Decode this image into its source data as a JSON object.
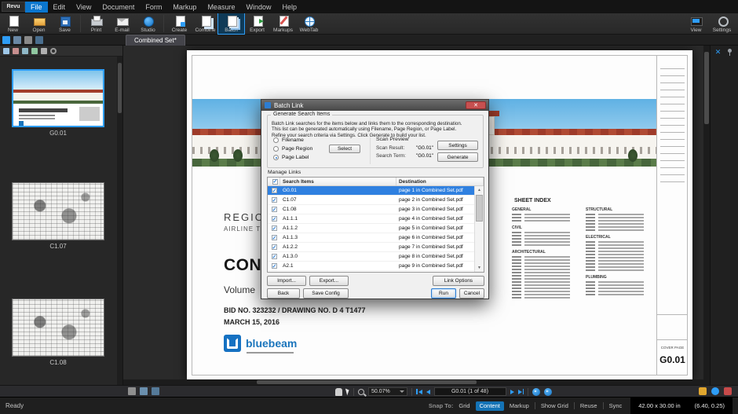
{
  "app": {
    "logo_text": "Revu",
    "menu_items": [
      "File",
      "Edit",
      "View",
      "Document",
      "Form",
      "Markup",
      "Measure",
      "Window",
      "Help"
    ],
    "active_menu": "File"
  },
  "toolbar": {
    "left_groups": [
      [
        {
          "label": "New",
          "icon": "new-document-icon"
        },
        {
          "label": "Open",
          "icon": "open-folder-icon"
        },
        {
          "label": "Save",
          "icon": "save-icon"
        }
      ],
      [
        {
          "label": "Print",
          "icon": "printer-icon"
        },
        {
          "label": "E-mail",
          "icon": "email-icon"
        },
        {
          "label": "Studio",
          "icon": "studio-icon"
        }
      ],
      [
        {
          "label": "Create",
          "icon": "create-icon"
        },
        {
          "label": "Combine",
          "icon": "combine-icon"
        },
        {
          "label": "Batch",
          "icon": "batch-icon",
          "active": true
        },
        {
          "label": "Export",
          "icon": "export-icon"
        },
        {
          "label": "Markups",
          "icon": "markups-icon"
        },
        {
          "label": "WebTab",
          "icon": "webtab-icon"
        }
      ]
    ],
    "right_group": [
      {
        "label": "View",
        "icon": "view-icon"
      },
      {
        "label": "Settings",
        "icon": "settings-icon"
      }
    ]
  },
  "tab_bar": {
    "active_tab": "Combined Set*",
    "left_icons": [
      "properties-panel-icon",
      "file-access-panel-icon",
      "thumbnails-panel-icon",
      "bookmarks-panel-icon"
    ]
  },
  "right_dock_icons": [
    "close-panel-icon",
    "pin-panel-icon"
  ],
  "thumbnail_panel": {
    "toolbar_icons": [
      "insert-page-icon",
      "delete-page-icon",
      "rotate-left-icon",
      "rotate-right-icon",
      "page-options-icon",
      "panel-gear-icon"
    ],
    "thumbnails": [
      {
        "label": "G0.01",
        "kind": "cover",
        "selected": true
      },
      {
        "label": "C1.07",
        "kind": "plan",
        "selected": false
      },
      {
        "label": "C1.08",
        "kind": "plan",
        "selected": false
      }
    ]
  },
  "document": {
    "title_line": "REGIONAL AIRPORT",
    "subtitle_line": "AIRLINE TERMINAL",
    "heading": "CONSTRUCTION DOCUMENTS",
    "volume_line": "Volume",
    "bid_line": "BID NO. 323232 /  DRAWING NO. D 4 T1477",
    "date_line": "MARCH 15, 2016",
    "brand_name": "bluebeam",
    "sheet_index": {
      "title": "SHEET INDEX",
      "col1_sections": [
        {
          "name": "GENERAL",
          "rows": 3
        },
        {
          "name": "CIVIL",
          "rows": 5
        },
        {
          "name": "ARCHITECTURAL",
          "rows": 14
        }
      ],
      "col2_sections": [
        {
          "name": "STRUCTURAL",
          "rows": 6
        },
        {
          "name": "ELECTRICAL",
          "rows": 10
        },
        {
          "name": "PLUMBING",
          "rows": 5
        }
      ]
    },
    "title_block": {
      "sheet_name": "COVER PAGE",
      "sheet_number": "G0.01"
    }
  },
  "dialog": {
    "title": "Batch Link",
    "generate_group": {
      "label": "Generate Search Items",
      "description": [
        "Batch Link searches for the items below and links them to the corresponding destination.",
        "This list can be generated automatically using Filename, Page Region, or Page Label.",
        "Refine your search criteria via Settings. Click Generate to build your list."
      ],
      "radios": [
        {
          "label": "Filename",
          "selected": false
        },
        {
          "label": "Page Region",
          "selected": false
        },
        {
          "label": "Page Label",
          "selected": true
        }
      ],
      "select_button": "Select",
      "scan_preview": {
        "title": "Scan Preview",
        "scan_result_label": "Scan Result:",
        "scan_result_value": "\"G0.01\"",
        "search_term_label": "Search Term:",
        "search_term_value": "\"G0.01\""
      },
      "settings_button": "Settings",
      "generate_button": "Generate"
    },
    "manage_links": {
      "label": "Manage Links",
      "columns": [
        "Search Items",
        "Destination"
      ],
      "rows": [
        {
          "checked": true,
          "item": "G0.01",
          "dest": "page 1 in Combined Set.pdf",
          "selected": true
        },
        {
          "checked": true,
          "item": "C1.07",
          "dest": "page 2 in Combined Set.pdf",
          "selected": false
        },
        {
          "checked": true,
          "item": "C1.08",
          "dest": "page 3 in Combined Set.pdf",
          "selected": false
        },
        {
          "checked": true,
          "item": "A1.1.1",
          "dest": "page 4 in Combined Set.pdf",
          "selected": false
        },
        {
          "checked": true,
          "item": "A1.1.2",
          "dest": "page 5 in Combined Set.pdf",
          "selected": false
        },
        {
          "checked": true,
          "item": "A1.1.3",
          "dest": "page 6 in Combined Set.pdf",
          "selected": false
        },
        {
          "checked": true,
          "item": "A1.2.2",
          "dest": "page 7 in Combined Set.pdf",
          "selected": false
        },
        {
          "checked": true,
          "item": "A1.3.0",
          "dest": "page 8 in Combined Set.pdf",
          "selected": false
        },
        {
          "checked": true,
          "item": "A2.1",
          "dest": "page 9 in Combined Set.pdf",
          "selected": false
        }
      ]
    },
    "buttons": {
      "import": "Import...",
      "export": "Export...",
      "link_options": "Link Options",
      "back": "Back",
      "save_config": "Save Config",
      "run": "Run",
      "cancel": "Cancel"
    }
  },
  "nav_bar": {
    "zoom_value": "50.07%",
    "page_display": "G0.01 (1 of 48)",
    "left_icons": [
      "single-page-mode-icon",
      "continuous-mode-icon",
      "split-view-icon"
    ],
    "right_icons": [
      "document-status-icon",
      "user-profile-icon",
      "alerts-icon"
    ]
  },
  "status_bar": {
    "ready_text": "Ready",
    "snap_label": "Snap To:",
    "snap_grid": "Grid",
    "snap_content": "Content",
    "snap_markup": "Markup",
    "show_grid": "Show Grid",
    "reuse": "Reuse",
    "sync": "Sync",
    "page_size": "42.00 x 30.00 in",
    "cursor_coords": "(6.40, 0.25)"
  }
}
